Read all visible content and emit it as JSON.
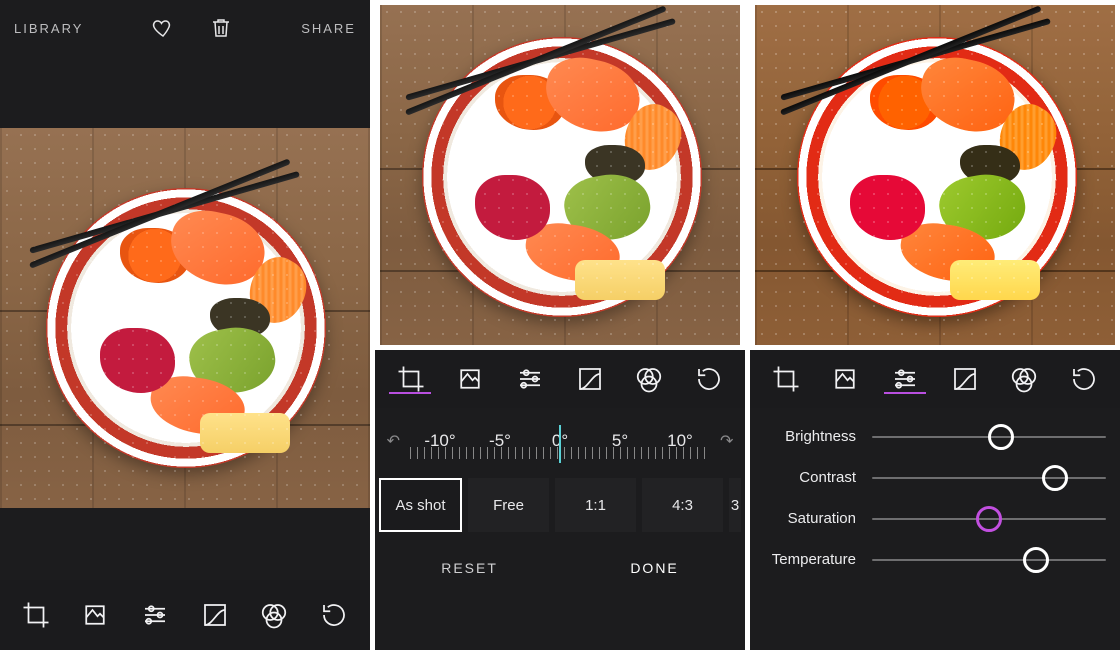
{
  "topbar": {
    "library_label": "LIBRARY",
    "share_label": "SHARE"
  },
  "toolbar": {
    "items": [
      "crop",
      "stack",
      "sliders",
      "curves",
      "filters",
      "history"
    ]
  },
  "crop": {
    "angle_marks": [
      "-10°",
      "-5°",
      "0°",
      "5°",
      "10°"
    ],
    "aspect_ratios": [
      {
        "label": "As shot",
        "selected": true
      },
      {
        "label": "Free",
        "selected": false
      },
      {
        "label": "1:1",
        "selected": false
      },
      {
        "label": "4:3",
        "selected": false
      }
    ],
    "reset_label": "RESET",
    "done_label": "DONE"
  },
  "sliders": {
    "items": [
      {
        "name": "Brightness",
        "pos": 0.55,
        "accent": false
      },
      {
        "name": "Contrast",
        "pos": 0.78,
        "accent": false
      },
      {
        "name": "Saturation",
        "pos": 0.5,
        "accent": true
      },
      {
        "name": "Temperature",
        "pos": 0.7,
        "accent": false
      }
    ]
  },
  "panel_active": {
    "screen2": "crop",
    "screen3": "sliders"
  }
}
